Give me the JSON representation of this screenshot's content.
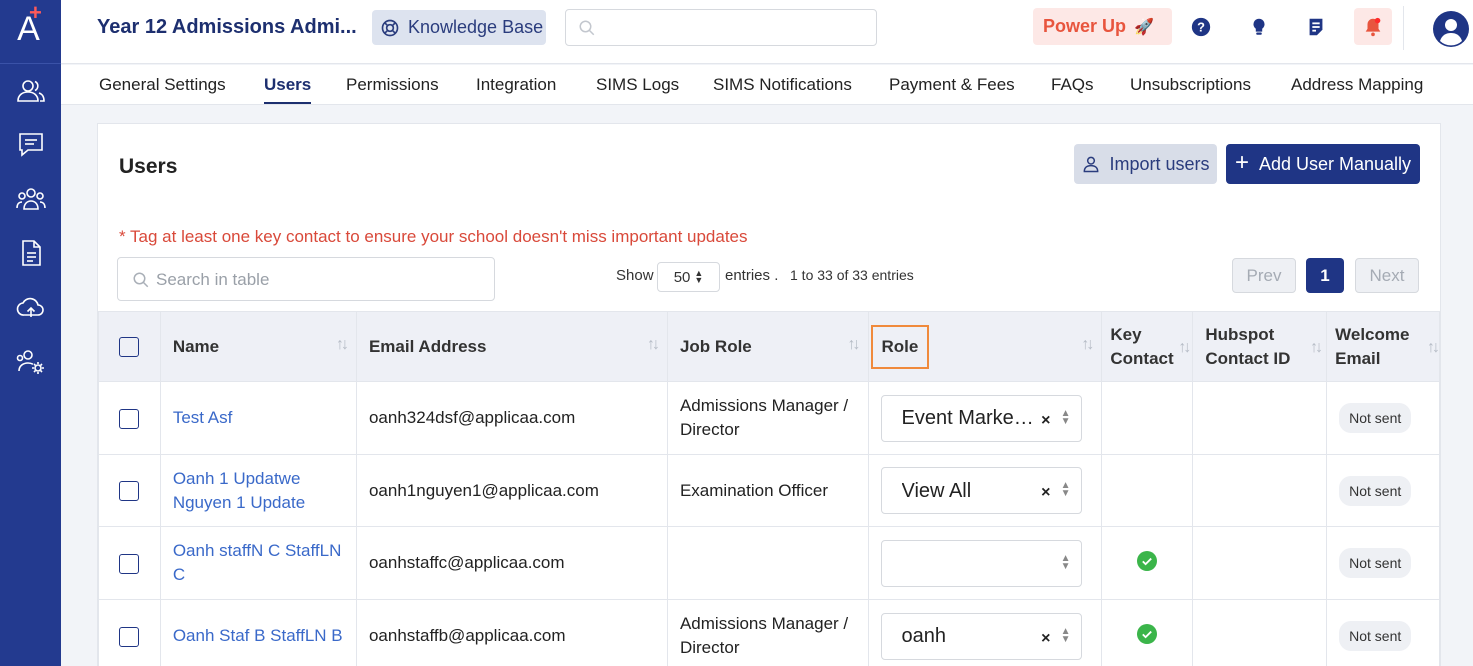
{
  "app": {
    "title": "Year 12 Admissions Admi...",
    "knowledge_base": "Knowledge Base",
    "power_up": "Power Up"
  },
  "colors": {
    "sidebar": "#233a8f",
    "primary": "#1f3585",
    "link": "#3a69c9",
    "warning": "#d9493a",
    "highlight": "#f08a3c",
    "success": "#3bb54a"
  },
  "sidebar": {
    "items": [
      "users-icon",
      "chat-icon",
      "group-icon",
      "document-icon",
      "cloud-upload-icon",
      "user-settings-icon"
    ]
  },
  "nav": {
    "tabs": [
      "General Settings",
      "Users",
      "Permissions",
      "Integration",
      "SIMS Logs",
      "SIMS Notifications",
      "Payment & Fees",
      "FAQs",
      "Unsubscriptions",
      "Address Mapping"
    ],
    "active": "Users"
  },
  "users": {
    "title": "Users",
    "import_label": "Import users",
    "add_label": "Add User Manually",
    "warning": "* Tag at least one key contact to ensure your school doesn't miss important updates",
    "search_placeholder": "Search in table",
    "show_label": "Show",
    "page_size": "50",
    "entries_label": "entries .",
    "count_text": "1 to 33 of 33 entries",
    "prev": "Prev",
    "page": "1",
    "next": "Next"
  },
  "table": {
    "headers": [
      "Name",
      "Email Address",
      "Job Role",
      "Role",
      "Key Contact",
      "Hubspot Contact ID",
      "Welcome Email"
    ],
    "rows": [
      {
        "name": "Test Asf",
        "email": "oanh324dsf@applicaa.com",
        "job_role": "Admissions Manager / Director",
        "role": "Event Marke…",
        "key_contact": false,
        "hubspot": "",
        "welcome": "Not sent"
      },
      {
        "name": "Oanh 1 Updatwe Nguyen 1 Update",
        "email": "oanh1nguyen1@applicaa.com",
        "job_role": "Examination Officer",
        "role": "View All",
        "key_contact": false,
        "hubspot": "",
        "welcome": "Not sent"
      },
      {
        "name": "Oanh staffN C StaffLN C",
        "email": "oanhstaffc@applicaa.com",
        "job_role": "",
        "role": "",
        "key_contact": true,
        "hubspot": "",
        "welcome": "Not sent"
      },
      {
        "name": "Oanh Staf B StaffLN B",
        "email": "oanhstaffb@applicaa.com",
        "job_role": "Admissions Manager / Director",
        "role": "oanh",
        "key_contact": true,
        "hubspot": "",
        "welcome": "Not sent"
      }
    ]
  }
}
